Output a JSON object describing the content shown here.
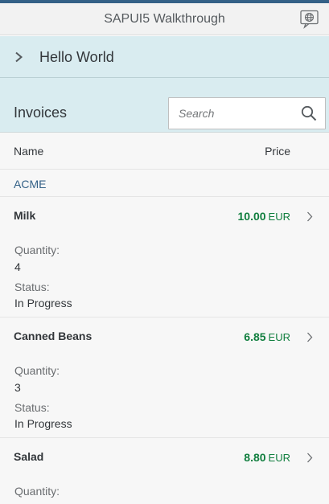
{
  "shell": {
    "title": "SAPUI5 Walkthrough",
    "globe_icon": "globe-icon"
  },
  "hello": {
    "label": "Hello World",
    "icon": "chevron-right-icon"
  },
  "invoices": {
    "title": "Invoices",
    "search_placeholder": "Search",
    "search_icon": "search-icon"
  },
  "columns": {
    "name": "Name",
    "price": "Price"
  },
  "group": {
    "label": "ACME"
  },
  "items": [
    {
      "product": "Milk",
      "amount": "10.00",
      "currency": "EUR",
      "quantity_label": "Quantity:",
      "quantity": "4",
      "status_label": "Status:",
      "status": "In Progress"
    },
    {
      "product": "Canned Beans",
      "amount": "6.85",
      "currency": "EUR",
      "quantity_label": "Quantity:",
      "quantity": "3",
      "status_label": "Status:",
      "status": "In Progress"
    },
    {
      "product": "Salad",
      "amount": "8.80",
      "currency": "EUR",
      "quantity_label": "Quantity:"
    }
  ],
  "colors": {
    "accent": "#346187",
    "amount_positive": "#107e3e",
    "header_bg": "#d9ecf0",
    "list_bg": "#f7f7f7"
  }
}
